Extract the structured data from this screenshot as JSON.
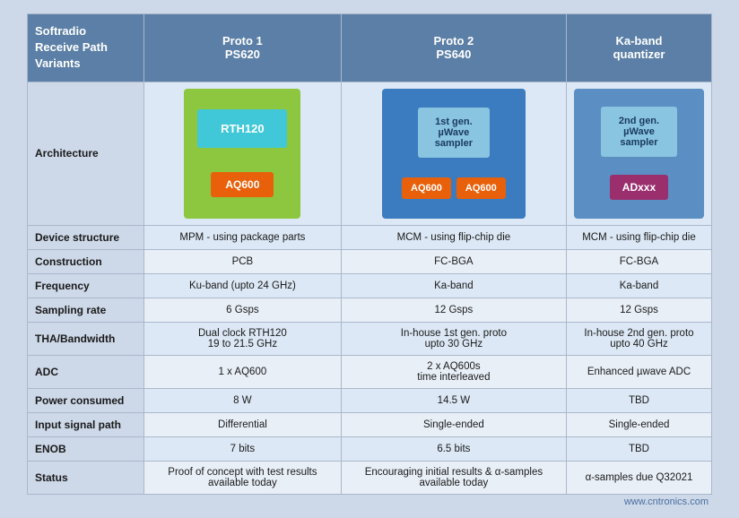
{
  "header": {
    "col0": "Softradio\nReceive Path\nVariants",
    "col1_line1": "Proto 1",
    "col1_line2": "PS620",
    "col2_line1": "Proto 2",
    "col2_line2": "PS640",
    "col3_line1": "Ka-band",
    "col3_line2": "quantizer"
  },
  "rows": [
    {
      "label": "Architecture",
      "col1": "",
      "col2": "",
      "col3": "",
      "type": "arch"
    },
    {
      "label": "Device structure",
      "col1": "MPM - using package parts",
      "col2": "MCM - using flip-chip die",
      "col3": "MCM - using flip-chip die",
      "type": "data"
    },
    {
      "label": "Construction",
      "col1": "PCB",
      "col2": "FC-BGA",
      "col3": "FC-BGA",
      "type": "data-alt"
    },
    {
      "label": "Frequency",
      "col1": "Ku-band (upto 24 GHz)",
      "col2": "Ka-band",
      "col3": "Ka-band",
      "type": "data"
    },
    {
      "label": "Sampling rate",
      "col1": "6 Gsps",
      "col2": "12 Gsps",
      "col3": "12 Gsps",
      "type": "data-alt"
    },
    {
      "label": "THA/Bandwidth",
      "col1": "Dual clock RTH120\n19 to 21.5 GHz",
      "col2": "In-house 1st gen. proto\nupto 30 GHz",
      "col3": "In-house 2nd gen. proto\nupto 40 GHz",
      "type": "data"
    },
    {
      "label": "ADC",
      "col1": "1 x AQ600",
      "col2": "2 x AQ600s\ntime interleaved",
      "col3": "Enhanced µwave ADC",
      "type": "data-alt"
    },
    {
      "label": "Power consumed",
      "col1": "8 W",
      "col2": "14.5 W",
      "col3": "TBD",
      "type": "data"
    },
    {
      "label": "Input signal path",
      "col1": "Differential",
      "col2": "Single-ended",
      "col3": "Single-ended",
      "type": "data-alt"
    },
    {
      "label": "ENOB",
      "col1": "7 bits",
      "col2": "6.5 bits",
      "col3": "TBD",
      "type": "data"
    },
    {
      "label": "Status",
      "col1": "Proof of concept with test results available today",
      "col2": "Encouraging initial results & α-samples available today",
      "col3": "α-samples due Q32021",
      "type": "data-alt"
    }
  ],
  "arch": {
    "proto1": {
      "chip1": "RTH120",
      "chip2": "AQ600"
    },
    "proto2": {
      "chip1_line1": "1st gen.",
      "chip1_line2": "µWave",
      "chip1_line3": "sampler",
      "chip2a": "AQ600",
      "chip2b": "AQ600"
    },
    "kaband": {
      "chip1_line1": "2nd gen.",
      "chip1_line2": "µWave",
      "chip1_line3": "sampler",
      "chip2": "ADxxx"
    }
  },
  "watermark": "www.cntronics.com"
}
